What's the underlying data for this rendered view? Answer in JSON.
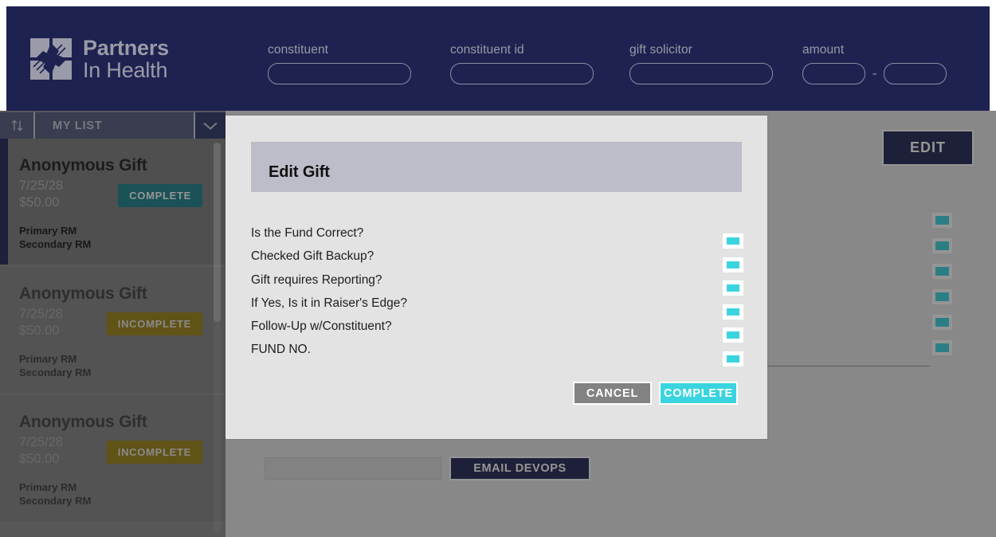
{
  "header": {
    "brand": {
      "line1": "Partners",
      "line2": "In Health",
      "logo_icon": "pih-logo-icon"
    },
    "search_fields": [
      {
        "label": "constituent",
        "value": "",
        "placeholder": ""
      },
      {
        "label": "constituent id",
        "value": "",
        "placeholder": ""
      },
      {
        "label": "gift solicitor",
        "value": "",
        "placeholder": ""
      }
    ],
    "amount": {
      "label": "amount",
      "min_value": "",
      "max_value": "",
      "separator": "-"
    }
  },
  "sidebar": {
    "toolbar": {
      "sort_icon": "sort-up-down-icon",
      "list_name": "MY LIST",
      "caret_icon": "chevron-down-icon"
    },
    "cards": [
      {
        "name": "Anonymous Gift",
        "date": "7/25/28",
        "amount": "$50.00",
        "status": "COMPLETE",
        "primary_rm": "Primary RM",
        "secondary_rm": "Secondary RM"
      },
      {
        "name": "Anonymous Gift",
        "date": "7/25/28",
        "amount": "$50.00",
        "status": "INCOMPLETE",
        "primary_rm": "Primary RM",
        "secondary_rm": "Secondary RM"
      },
      {
        "name": "Anonymous Gift",
        "date": "7/25/28",
        "amount": "$50.00",
        "status": "INCOMPLETE",
        "primary_rm": "Primary RM",
        "secondary_rm": "Secondary RM"
      }
    ]
  },
  "main": {
    "edit_label": "EDIT",
    "checkbox_count": 6,
    "devops": {
      "input_value": "",
      "button_label": "EMAIL DEVOPS"
    }
  },
  "modal": {
    "title": "Edit Gift",
    "questions": [
      "Is the Fund Correct?",
      "Checked Gift Backup?",
      "Gift requires Reporting?",
      "If Yes, Is it in Raiser's Edge?",
      "Follow-Up w/Constituent?",
      "FUND NO."
    ],
    "cancel_label": "CANCEL",
    "complete_label": "COMPLETE"
  },
  "colors": {
    "navy": "#1e2250",
    "cyan": "#3ad4e0",
    "teal": "#17818c",
    "gold": "#ab8b09",
    "modal_bg": "#e3e3e3",
    "modal_title_bar": "#bdbdc9",
    "sidebar_bg": "#838383"
  }
}
